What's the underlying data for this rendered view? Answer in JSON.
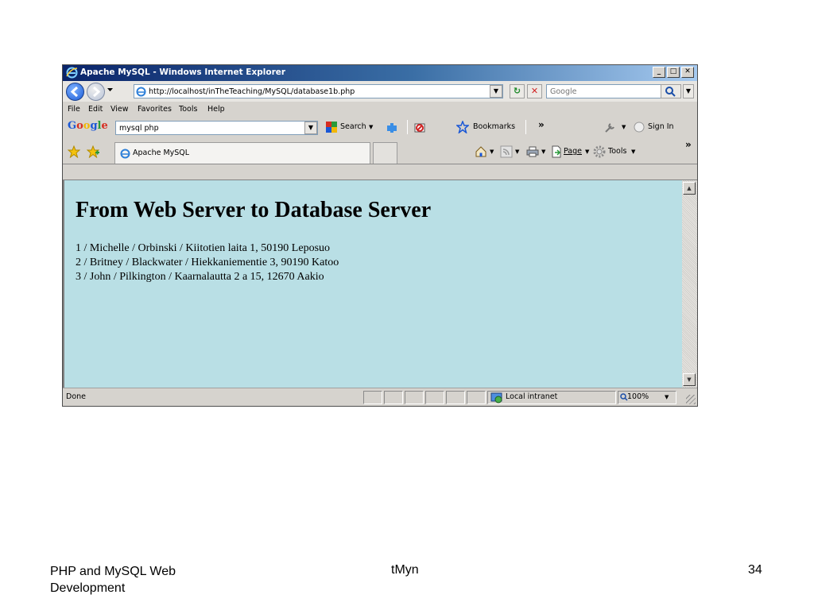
{
  "window": {
    "title": "Apache MySQL - Windows Internet Explorer",
    "minimize": "_",
    "maximize": "□",
    "close": "✕"
  },
  "address": {
    "url": "http://localhost/inTheTeaching/MySQL/database1b.php",
    "search_placeholder": "Google"
  },
  "menu": [
    "File",
    "Edit",
    "View",
    "Favorites",
    "Tools",
    "Help"
  ],
  "google_toolbar": {
    "logo": "Google",
    "query": "mysql php",
    "search_label": "Search",
    "bookmarks_label": "Bookmarks",
    "more": "»",
    "sign_in": "Sign In"
  },
  "tabs": {
    "active_label": "Apache MySQL",
    "page_label": "Page",
    "tools_label": "Tools",
    "more": "»"
  },
  "page": {
    "heading": "From Web Server to Database Server",
    "records": [
      "1 / Michelle / Orbinski / Kiitotien laita 1, 50190 Leposuo",
      "2 / Britney / Blackwater / Hiekkaniementie 3, 90190 Katoo",
      "3 / John / Pilkington / Kaarnalautta 2 a 15, 12670 Aakio"
    ]
  },
  "status": {
    "text": "Done",
    "zone": "Local intranet",
    "zoom": "100%"
  },
  "footer": {
    "left": "PHP and MySQL Web Development",
    "center": "tMyn",
    "page_number": "34"
  },
  "colors": {
    "content_background": "#b9dfe5",
    "titlebar": "#0a246a"
  }
}
